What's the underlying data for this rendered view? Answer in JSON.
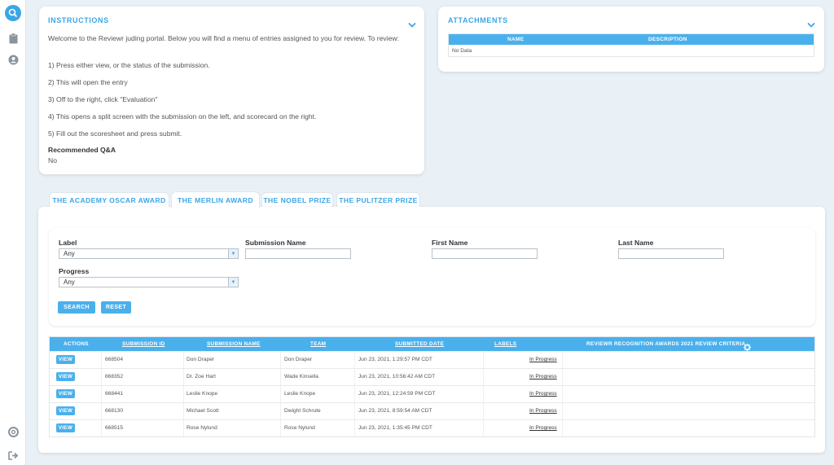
{
  "instructions": {
    "title": "INSTRUCTIONS",
    "intro": "Welcome to the Reviewr juding portal. Below you will find a menu of entries assigned to you for review. To review:",
    "steps": [
      "1) Press either view, or the status of the submission.",
      "2) This will open the entry",
      "3) Off to the right, click \"Evaluation\"",
      "4) This opens a split screen with the submission on the left, and scorecard on the right.",
      "5) Fill out the scoresheet and press submit."
    ],
    "qa_label": "Recommended Q&A",
    "qa_value": "No"
  },
  "attachments": {
    "title": "ATTACHMENTS",
    "col_name": "NAME",
    "col_description": "DESCRIPTION",
    "empty": "No Data"
  },
  "tabs": [
    {
      "label": "THE ACADEMY OSCAR AWARD"
    },
    {
      "label": "THE MERLIN AWARD"
    },
    {
      "label": "THE NOBEL PRIZE"
    },
    {
      "label": "THE PULITZER PRIZE"
    }
  ],
  "active_tab": "THE MERLIN AWARD",
  "filters": {
    "label_label": "Label",
    "label_value": "Any",
    "submission_name_label": "Submission Name",
    "first_name_label": "First Name",
    "last_name_label": "Last Name",
    "progress_label": "Progress",
    "progress_value": "Any",
    "search_button": "SEARCH",
    "reset_button": "RESET"
  },
  "table": {
    "headers": {
      "actions": "ACTIONS",
      "submission_id": "SUBMISSION ID",
      "submission_name": "SUBMISSION NAME",
      "team": "TEAM",
      "submitted_date": "SUBMITTED DATE",
      "labels": "LABELS",
      "criteria": "REVIEWR RECOGNITION AWARDS 2021 REVIEW CRITERIA"
    },
    "view_label": "VIEW",
    "rows": [
      {
        "id": "668504",
        "name": "Don Draper",
        "team": "Don Draper",
        "date": "Jun 23, 2021, 1:29:57 PM CDT",
        "progress": "In Progress"
      },
      {
        "id": "668352",
        "name": "Dr. Zoe Hart",
        "team": "Wade Kinsella",
        "date": "Jun 23, 2021, 10:56:42 AM CDT",
        "progress": "In Progress"
      },
      {
        "id": "668441",
        "name": "Leslie Knope",
        "team": "Leslie Knope",
        "date": "Jun 23, 2021, 12:24:59 PM CDT",
        "progress": "In Progress"
      },
      {
        "id": "668130",
        "name": "Michael Scott",
        "team": "Dwight Schrute",
        "date": "Jun 23, 2021, 8:59:54 AM CDT",
        "progress": "In Progress"
      },
      {
        "id": "668515",
        "name": "Rose Nylund",
        "team": "Rose Nylund",
        "date": "Jun 23, 2021, 1:35:45 PM CDT",
        "progress": "In Progress"
      }
    ]
  },
  "colors": {
    "accent": "#4ab0ec",
    "title": "#3aa6e6",
    "background": "#eaf1f6"
  }
}
